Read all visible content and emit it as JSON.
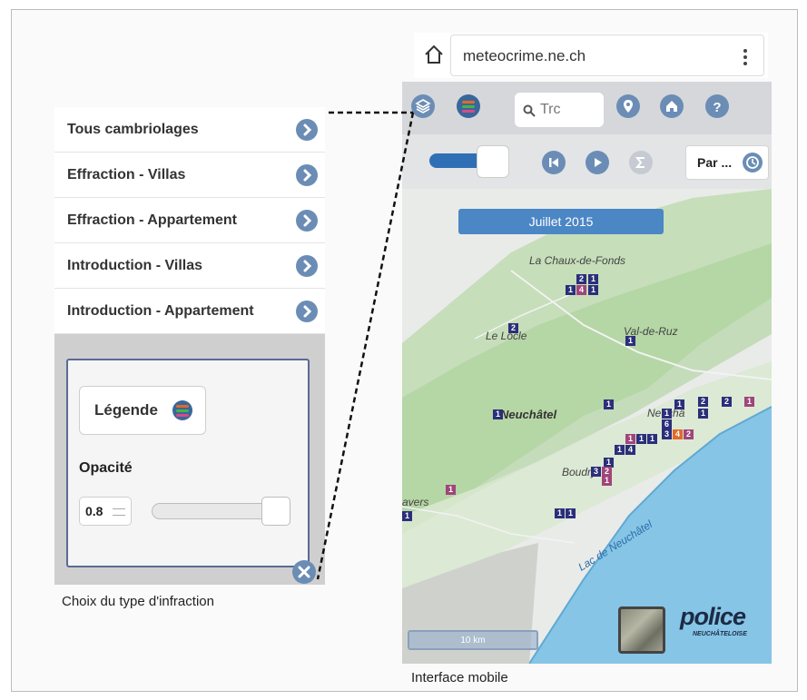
{
  "left_panel": {
    "menu_items": [
      {
        "label": "Tous cambriolages"
      },
      {
        "label": "Effraction - Villas"
      },
      {
        "label": "Effraction - Appartement"
      },
      {
        "label": "Introduction - Villas"
      },
      {
        "label": "Introduction - Appartement"
      }
    ],
    "legend_button_label": "Légende",
    "opacity_label": "Opacité",
    "opacity_value": "0.8",
    "opacity_level": 0.8,
    "caption": "Choix du type d'infraction"
  },
  "browser": {
    "url": "meteocrime.ne.ch"
  },
  "mobile_app": {
    "search_placeholder": "Trc",
    "period_button_label": "Par ...",
    "date_label": "Juillet 2015",
    "map_places": {
      "chaux_de_fonds": "La Chaux-de-Fonds",
      "le_locle": "Le Locle",
      "val_de_ruz": "Val-de-Ruz",
      "neuchatel": "Neuchâtel",
      "neuchatel_east": "Neuchâ",
      "boudry": "Boudry",
      "travers": "avers",
      "lake": "Lac de Neuchâtel"
    },
    "markers": [
      "2",
      "1",
      "1",
      "4",
      "1",
      "2",
      "1",
      "1",
      "1",
      "1",
      "1",
      "2",
      "1",
      "2",
      "1",
      "6",
      "3",
      "4",
      "2",
      "1",
      "1",
      "1",
      "1",
      "4",
      "1",
      "3",
      "2",
      "1",
      "1",
      "1",
      "1",
      "1"
    ],
    "scale_label": "10 km",
    "logo_text": "police",
    "logo_subtext": "NEUCHÂTELOISE",
    "caption": "Interface mobile"
  },
  "colors": {
    "accent_blue": "#6b8db5",
    "marker_navy": "#2b2f7a",
    "marker_purple": "#a0457a",
    "marker_orange": "#e06a2a",
    "date_badge": "#4b86c5",
    "lake": "#86c5e6"
  },
  "icons": [
    "home-icon",
    "kebab-menu-icon",
    "layers-icon",
    "legend-icon",
    "search-icon",
    "location-pin-icon",
    "home-icon",
    "help-icon",
    "skip-back-icon",
    "play-icon",
    "sum-icon",
    "clock-icon",
    "chevron-right-icon",
    "close-icon"
  ]
}
